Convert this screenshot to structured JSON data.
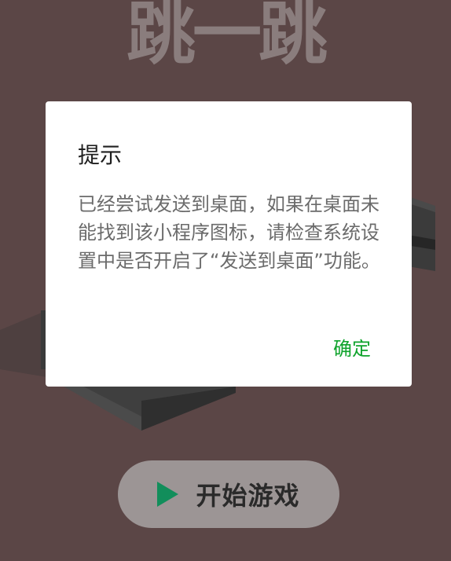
{
  "game": {
    "title": "跳一跳",
    "start_label": "开始游戏"
  },
  "dialog": {
    "title": "提示",
    "message": "已经尝试发送到桌面，如果在桌面未能找到该小程序图标，请检查系统设置中是否开启了“发送到桌面”功能。",
    "confirm_label": "确定"
  },
  "colors": {
    "background": "#5b4646",
    "accent": "#0fa32c",
    "play": "#128e5b"
  },
  "icons": {
    "play": "play-icon"
  }
}
